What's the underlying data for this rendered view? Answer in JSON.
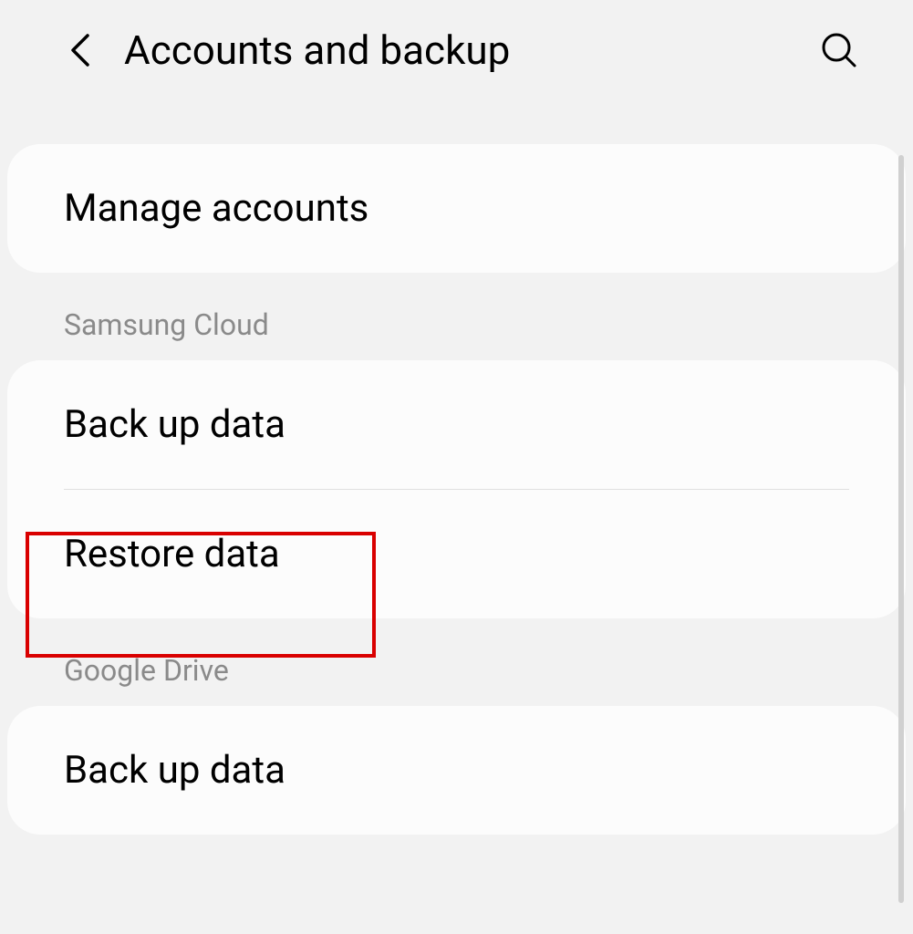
{
  "header": {
    "title": "Accounts and backup"
  },
  "sections": {
    "manage_accounts": "Manage accounts",
    "samsung_cloud_header": "Samsung Cloud",
    "samsung_backup": "Back up data",
    "samsung_restore": "Restore data",
    "google_drive_header": "Google Drive",
    "google_backup": "Back up data"
  }
}
